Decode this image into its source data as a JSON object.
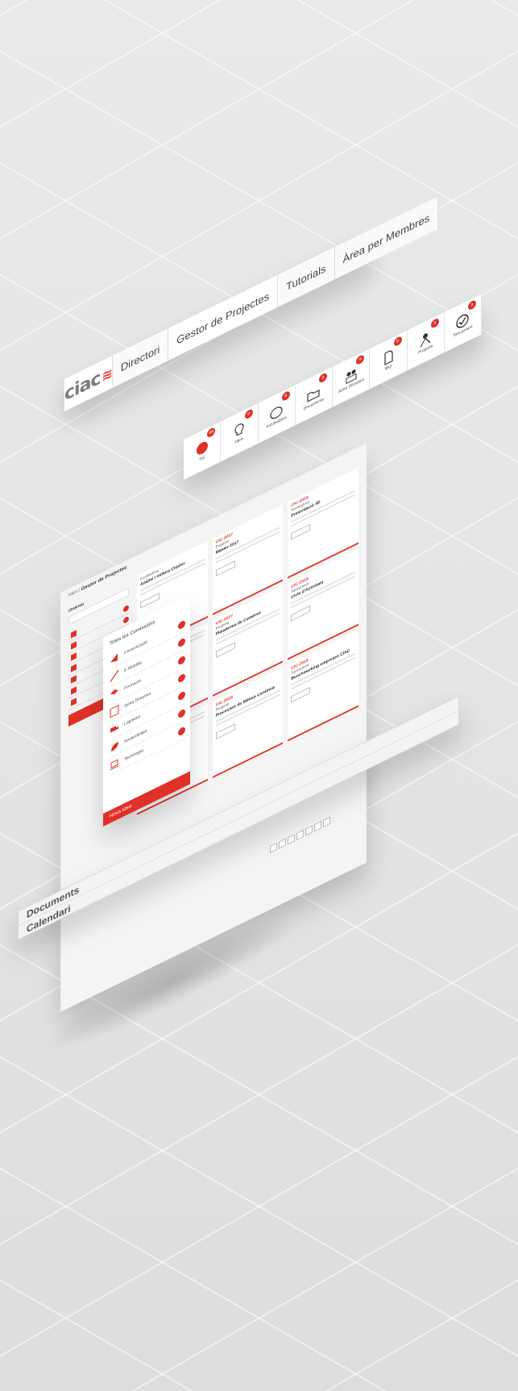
{
  "nav": {
    "logo_text": "ciac",
    "tabs": [
      "Directori",
      "Gestor de Projectes",
      "Tutorials",
      "Àrea per Membres"
    ],
    "active_tab": "Gestor de Projectes"
  },
  "categories": [
    {
      "label": "Tot",
      "icon": "all-icon",
      "badge": "99"
    },
    {
      "label": "Idea",
      "icon": "lightbulb-icon",
      "badge": "9"
    },
    {
      "label": "Incubadora",
      "icon": "incubator-icon",
      "badge": "9"
    },
    {
      "label": "Documents",
      "icon": "folder-icon",
      "badge": "9"
    },
    {
      "label": "Junta Directiva",
      "icon": "team-icon",
      "badge": "9"
    },
    {
      "label": "BIQ",
      "icon": "document-icon",
      "badge": "9"
    },
    {
      "label": "Projecte",
      "icon": "worker-icon",
      "badge": "9"
    },
    {
      "label": "Tancament",
      "icon": "checkmark-icon",
      "badge": "9"
    }
  ],
  "main": {
    "breadcrumb_home": "Inici",
    "breadcrumb_current": "Gestor de Projectes",
    "sidebar_label": "Ordenar"
  },
  "filter": {
    "title": "Totes les Comissions",
    "items": [
      {
        "label": "Comunicació",
        "icon": "megaphone-icon"
      },
      {
        "label": "E-Mobility",
        "icon": "chart-arrow-icon"
      },
      {
        "label": "Formació",
        "icon": "graduation-icon"
      },
      {
        "label": "Junta Directiva",
        "icon": "team-icon"
      },
      {
        "label": "Logística",
        "icon": "truck-icon"
      },
      {
        "label": "Sostenibilitat",
        "icon": "leaf-icon"
      },
      {
        "label": "Tecnologia",
        "icon": "laptop-icon"
      }
    ],
    "new_idea": "Nova Idea"
  },
  "projects": [
    {
      "year": "",
      "tag": "Incubadora",
      "title": "Anàlisi i millora Clúster"
    },
    {
      "year": "CIC-2017",
      "tag": "Projecte",
      "title": "Màster 2017"
    },
    {
      "year": "CIC-2016",
      "tag": "Incubadora",
      "title": "Presentació 3D"
    },
    {
      "year": "",
      "tag": "",
      "title": ""
    },
    {
      "year": "CIC-2017",
      "tag": "Projecte",
      "title": "Plataforma de Compres"
    },
    {
      "year": "CIC-2016",
      "tag": "Tancament",
      "title": "Cicle d'Activitats"
    },
    {
      "year": "",
      "tag": "",
      "title": ""
    },
    {
      "year": "CIC-2016",
      "tag": "Projecte",
      "title": "Processos de Millora Contínua"
    },
    {
      "year": "CIC-2016",
      "tag": "Tancament",
      "title": "Benchmarking empreses CIAC"
    }
  ],
  "links": [
    "Documents",
    "Calendari"
  ]
}
